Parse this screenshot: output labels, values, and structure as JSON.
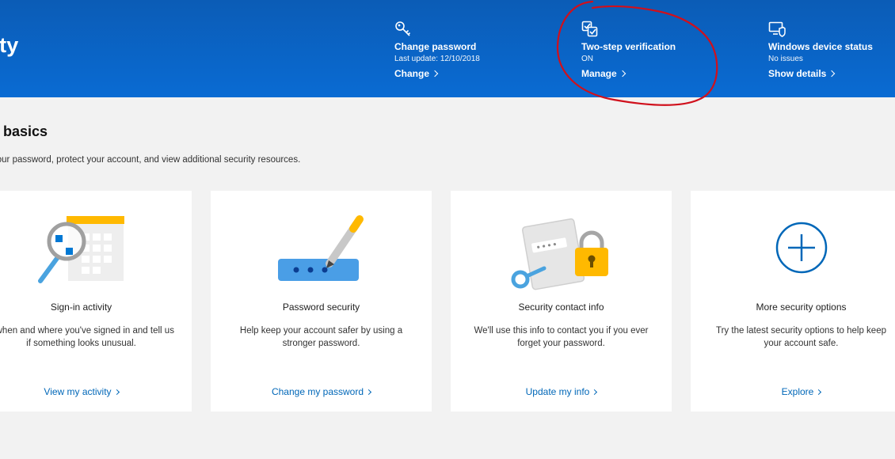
{
  "header": {
    "title": "urity",
    "status_items": [
      {
        "icon": "key-icon",
        "title": "Change password",
        "subtitle": "Last update: 12/10/2018",
        "link": "Change"
      },
      {
        "icon": "verification-checklist-icon",
        "title": "Two-step verification",
        "subtitle": "ON",
        "link": "Manage"
      },
      {
        "icon": "device-shield-icon",
        "title": "Windows device status",
        "subtitle": "No issues",
        "link": "Show details"
      }
    ]
  },
  "section": {
    "title": "ity basics",
    "description": "your password, protect your account, and view additional security resources."
  },
  "cards": [
    {
      "icon": "calendar-magnifier-icon",
      "title": "Sign-in activity",
      "description": "e when and where you've signed in and tell us if something looks unusual.",
      "link": "View my activity"
    },
    {
      "icon": "password-pen-icon",
      "title": "Password security",
      "description": "Help keep your account safer by using a stronger password.",
      "link": "Change my password"
    },
    {
      "icon": "contact-lock-icon",
      "title": "Security contact info",
      "description": "We'll use this info to contact you if you ever forget your password.",
      "link": "Update my info"
    },
    {
      "icon": "plus-circle-icon",
      "title": "More security options",
      "description": "Try the latest security options to help keep your account safe.",
      "link": "Explore"
    }
  ],
  "colors": {
    "header_blue": "#0a63c4",
    "link_blue": "#0067b8",
    "annotation_red": "#d0101c",
    "background": "#f2f2f2"
  }
}
